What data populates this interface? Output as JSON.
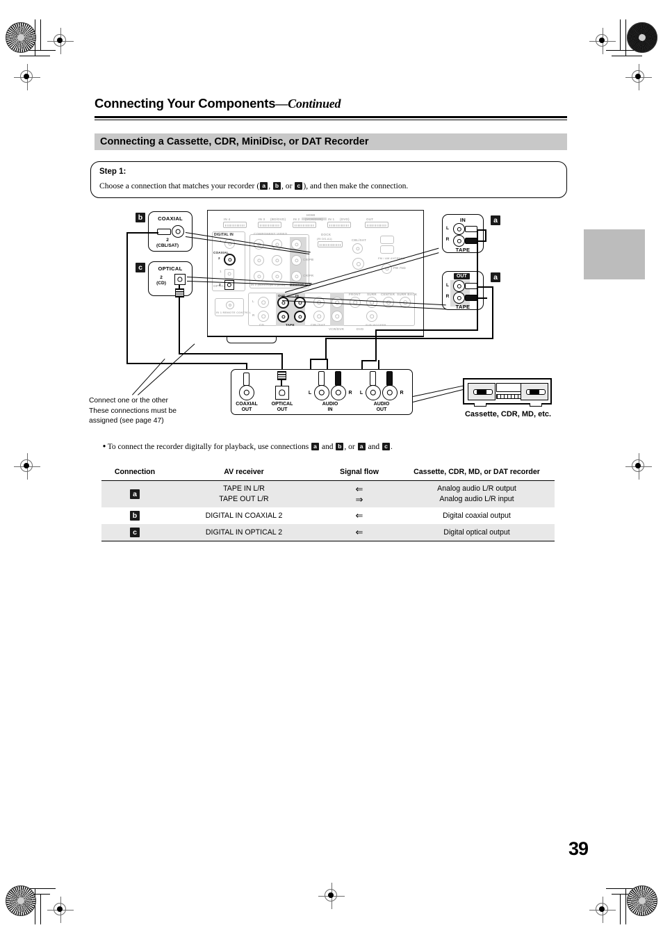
{
  "header": {
    "title_main": "Connecting Your Components",
    "title_cont": "—Continued",
    "section": "Connecting a Cassette, CDR, MiniDisc, or DAT Recorder"
  },
  "step": {
    "label": "Step 1:",
    "text_a": "Choose a connection that matches your recorder (",
    "chip_a": "a",
    "sep1": ", ",
    "chip_b": "b",
    "sep2": ", or ",
    "chip_c": "c",
    "text_b": "), and then make the connection."
  },
  "diagram": {
    "callout_b": {
      "badge": "b",
      "title": "COAXIAL",
      "num": "2",
      "sub": "(CBL/SAT)"
    },
    "callout_c": {
      "badge": "c",
      "title": "OPTICAL",
      "num": "2",
      "sub": "(CD)"
    },
    "callout_in": {
      "badge": "a",
      "title": "IN",
      "left": "L",
      "right": "R",
      "foot": "TAPE"
    },
    "callout_out": {
      "badge": "a",
      "title": "OUT",
      "left": "L",
      "right": "R",
      "foot": "TAPE"
    },
    "receiver": {
      "hdmi_group": "HDMI",
      "hdmi_ports": [
        "IN 4",
        "IN 3",
        "IN 2",
        "IN 1",
        "OUT"
      ],
      "hdmi_subs": [
        "",
        "(BD/DVD)",
        "(VCR/DVR)",
        "(DVD)",
        ""
      ],
      "digital_in": "DIGITAL IN",
      "coaxial": "COAXIAL",
      "coax_1": "1",
      "coax_2": "2",
      "optical": "OPTICAL",
      "opt_1": "1",
      "opt_2": "2",
      "component_video": "COMPONENT VIDEO",
      "comp_labels": [
        "IN 2 (BD/DVD)",
        "IN 1 (DVD)",
        "MONITOR OUT"
      ],
      "cb_pb": "CB/PB",
      "cr_pr": "CR/PR",
      "dock": "DOCK",
      "dock_sub": "(RI DS-A1)",
      "cbl_sat": "CBL/SAT",
      "antenna": "FM / AM ANTENNA",
      "fm_ohm": "FM 75Ω",
      "remote": "RI 1 REMOTE CONTROL",
      "analog_groups": [
        "CD",
        "TAPE",
        "CBL/SAT",
        "VCR/DVR",
        "DVD"
      ],
      "tape_out": "OUT",
      "tape_in": "IN",
      "pre_out": [
        "FRONT",
        "SURR",
        "CENTER",
        "SURR BACK",
        "SUB WOOFER"
      ],
      "monitor_out": "MONITOR OUT",
      "lr_l": "L",
      "lr_r": "R"
    },
    "recorder_panel": {
      "coaxial_out": "COAXIAL\nOUT",
      "coaxial_out_1": "COAXIAL",
      "coaxial_out_2": "OUT",
      "optical_out_1": "OPTICAL",
      "optical_out_2": "OUT",
      "audio_in_1": "AUDIO",
      "audio_in_2": "IN",
      "audio_out_1": "AUDIO",
      "audio_out_2": "OUT",
      "L": "L",
      "R": "R"
    },
    "deck_caption": "Cassette, CDR, MD, etc.",
    "note": "Connect one or the other\nThese connections must be\nassigned (see page 47)",
    "note_l1": "Connect one or the other",
    "note_l2": "These connections must be",
    "note_l3": "assigned (see page 47)"
  },
  "bullet": {
    "pre": "To connect the recorder digitally for playback, use connections ",
    "chip1": "a",
    "mid1": " and ",
    "chip2": "b",
    "mid2": ", or ",
    "chip3": "a",
    "mid3": " and ",
    "chip4": "c",
    "post": "."
  },
  "table": {
    "headers": [
      "Connection",
      "AV receiver",
      "Signal flow",
      "Cassette, CDR, MD, or DAT recorder"
    ],
    "rows": [
      {
        "conn": "a",
        "receiver_l1": "TAPE IN L/R",
        "receiver_l2": "TAPE OUT L/R",
        "flow_l1": "⇐",
        "flow_l2": "⇒",
        "device_l1": "Analog audio L/R output",
        "device_l2": "Analog audio L/R input"
      },
      {
        "conn": "b",
        "receiver_l1": "DIGITAL IN COAXIAL 2",
        "flow_l1": "⇐",
        "device_l1": "Digital coaxial output"
      },
      {
        "conn": "c",
        "receiver_l1": "DIGITAL IN OPTICAL 2",
        "flow_l1": "⇐",
        "device_l1": "Digital optical output"
      }
    ]
  },
  "page_number": "39",
  "colors": {
    "section_bar": "#c8c8c8",
    "table_alt_row": "#e8e8e8",
    "thumb_tab": "#bcbcbc",
    "chip_bg": "#1a1a1a"
  }
}
